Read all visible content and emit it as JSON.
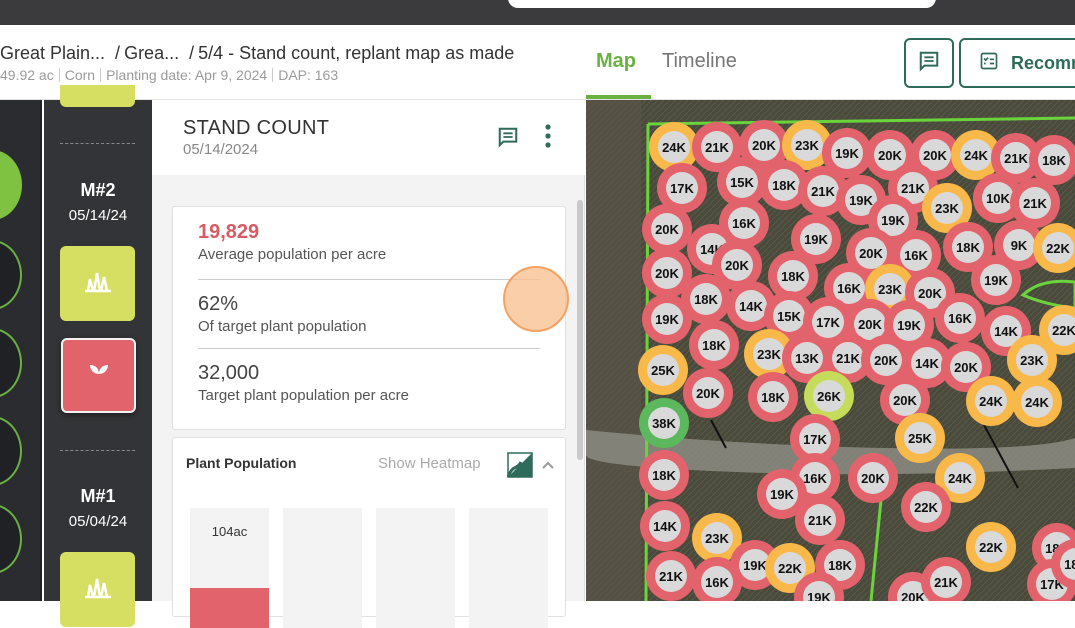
{
  "breadcrumb": {
    "items": [
      "Great Plain...",
      "Grea...",
      "5/4 - Stand count, replant map as made"
    ],
    "acres": "49.92 ac",
    "crop": "Corn",
    "planting": "Planting date: Apr 9, 2024",
    "dap": "DAP: 163"
  },
  "tabs": {
    "map": "Map",
    "timeline": "Timeline"
  },
  "header_buttons": {
    "recommend": "Recomm"
  },
  "timeline_items": [
    {
      "label": "M#2",
      "date": "05/14/24"
    },
    {
      "label": "M#1",
      "date": "05/04/24"
    }
  ],
  "panel": {
    "title": "STAND COUNT",
    "date": "05/14/2024",
    "stats": [
      {
        "value": "19,829",
        "label": "Average population per acre"
      },
      {
        "value": "62%",
        "label": "Of target plant population"
      },
      {
        "value": "32,000",
        "label": "Target plant population per acre"
      }
    ],
    "plant_population": {
      "title": "Plant Population",
      "heatmap": "Show Heatmap",
      "bar_label": "104ac"
    }
  },
  "colors": {
    "red": "#e3636c",
    "orange": "#f9b84a",
    "yellowgreen": "#c5dc5b",
    "green": "#5cb85c",
    "brand": "#6bb043",
    "dark_teal": "#2e6b5b"
  },
  "map_markers": [
    {
      "t": "24K",
      "c": "orange"
    },
    {
      "t": "21K",
      "c": "red"
    },
    {
      "t": "20K",
      "c": "red"
    },
    {
      "t": "23K",
      "c": "orange"
    },
    {
      "t": "19K",
      "c": "red"
    },
    {
      "t": "20K",
      "c": "red"
    },
    {
      "t": "20K",
      "c": "red"
    },
    {
      "t": "24K",
      "c": "orange"
    },
    {
      "t": "21K",
      "c": "red"
    },
    {
      "t": "18K",
      "c": "red"
    },
    {
      "t": "17K",
      "c": "red"
    },
    {
      "t": "15K",
      "c": "red"
    },
    {
      "t": "18K",
      "c": "red"
    },
    {
      "t": "21K",
      "c": "red"
    },
    {
      "t": "19K",
      "c": "red"
    },
    {
      "t": "21K",
      "c": "red"
    },
    {
      "t": "23K",
      "c": "orange"
    },
    {
      "t": "10K",
      "c": "red"
    },
    {
      "t": "21K",
      "c": "red"
    },
    {
      "t": "20K",
      "c": "red"
    },
    {
      "t": "16K",
      "c": "red"
    },
    {
      "t": "19K",
      "c": "red"
    },
    {
      "t": "19K",
      "c": "red"
    },
    {
      "t": "14K",
      "c": "red"
    },
    {
      "t": "20K",
      "c": "red"
    },
    {
      "t": "20K",
      "c": "red"
    },
    {
      "t": "16K",
      "c": "red"
    },
    {
      "t": "18K",
      "c": "red"
    },
    {
      "t": "9K",
      "c": "red"
    },
    {
      "t": "22K",
      "c": "orange"
    },
    {
      "t": "20K",
      "c": "red"
    },
    {
      "t": "18K",
      "c": "red"
    },
    {
      "t": "16K",
      "c": "red"
    },
    {
      "t": "23K",
      "c": "orange"
    },
    {
      "t": "20K",
      "c": "red"
    },
    {
      "t": "19K",
      "c": "red"
    },
    {
      "t": "19K",
      "c": "red"
    },
    {
      "t": "18K",
      "c": "red"
    },
    {
      "t": "14K",
      "c": "red"
    },
    {
      "t": "15K",
      "c": "red"
    },
    {
      "t": "17K",
      "c": "red"
    },
    {
      "t": "20K",
      "c": "red"
    },
    {
      "t": "19K",
      "c": "red"
    },
    {
      "t": "16K",
      "c": "red"
    },
    {
      "t": "14K",
      "c": "red"
    },
    {
      "t": "22K",
      "c": "orange"
    },
    {
      "t": "18K",
      "c": "red"
    },
    {
      "t": "23K",
      "c": "orange"
    },
    {
      "t": "13K",
      "c": "red"
    },
    {
      "t": "21K",
      "c": "red"
    },
    {
      "t": "20K",
      "c": "red"
    },
    {
      "t": "14K",
      "c": "red"
    },
    {
      "t": "20K",
      "c": "red"
    },
    {
      "t": "23K",
      "c": "orange"
    },
    {
      "t": "25K",
      "c": "orange"
    },
    {
      "t": "20K",
      "c": "red"
    },
    {
      "t": "18K",
      "c": "red"
    },
    {
      "t": "26K",
      "c": "yellowgreen"
    },
    {
      "t": "20K",
      "c": "red"
    },
    {
      "t": "24K",
      "c": "orange"
    },
    {
      "t": "24K",
      "c": "orange"
    },
    {
      "t": "38K",
      "c": "green"
    },
    {
      "t": "17K",
      "c": "red"
    },
    {
      "t": "25K",
      "c": "orange"
    },
    {
      "t": "18K",
      "c": "red"
    },
    {
      "t": "16K",
      "c": "red"
    },
    {
      "t": "20K",
      "c": "red"
    },
    {
      "t": "24K",
      "c": "orange"
    },
    {
      "t": "19K",
      "c": "red"
    },
    {
      "t": "21K",
      "c": "red"
    },
    {
      "t": "22K",
      "c": "red"
    },
    {
      "t": "14K",
      "c": "red"
    },
    {
      "t": "23K",
      "c": "orange"
    },
    {
      "t": "19K",
      "c": "red"
    },
    {
      "t": "18K",
      "c": "red"
    },
    {
      "t": "22K",
      "c": "orange"
    },
    {
      "t": "22K",
      "c": "orange"
    },
    {
      "t": "18K",
      "c": "red"
    },
    {
      "t": "21K",
      "c": "red"
    },
    {
      "t": "16K",
      "c": "red"
    },
    {
      "t": "19K",
      "c": "red"
    },
    {
      "t": "20K",
      "c": "red"
    },
    {
      "t": "21K",
      "c": "red"
    },
    {
      "t": "17K",
      "c": "red"
    },
    {
      "t": "18K",
      "c": "red"
    }
  ]
}
